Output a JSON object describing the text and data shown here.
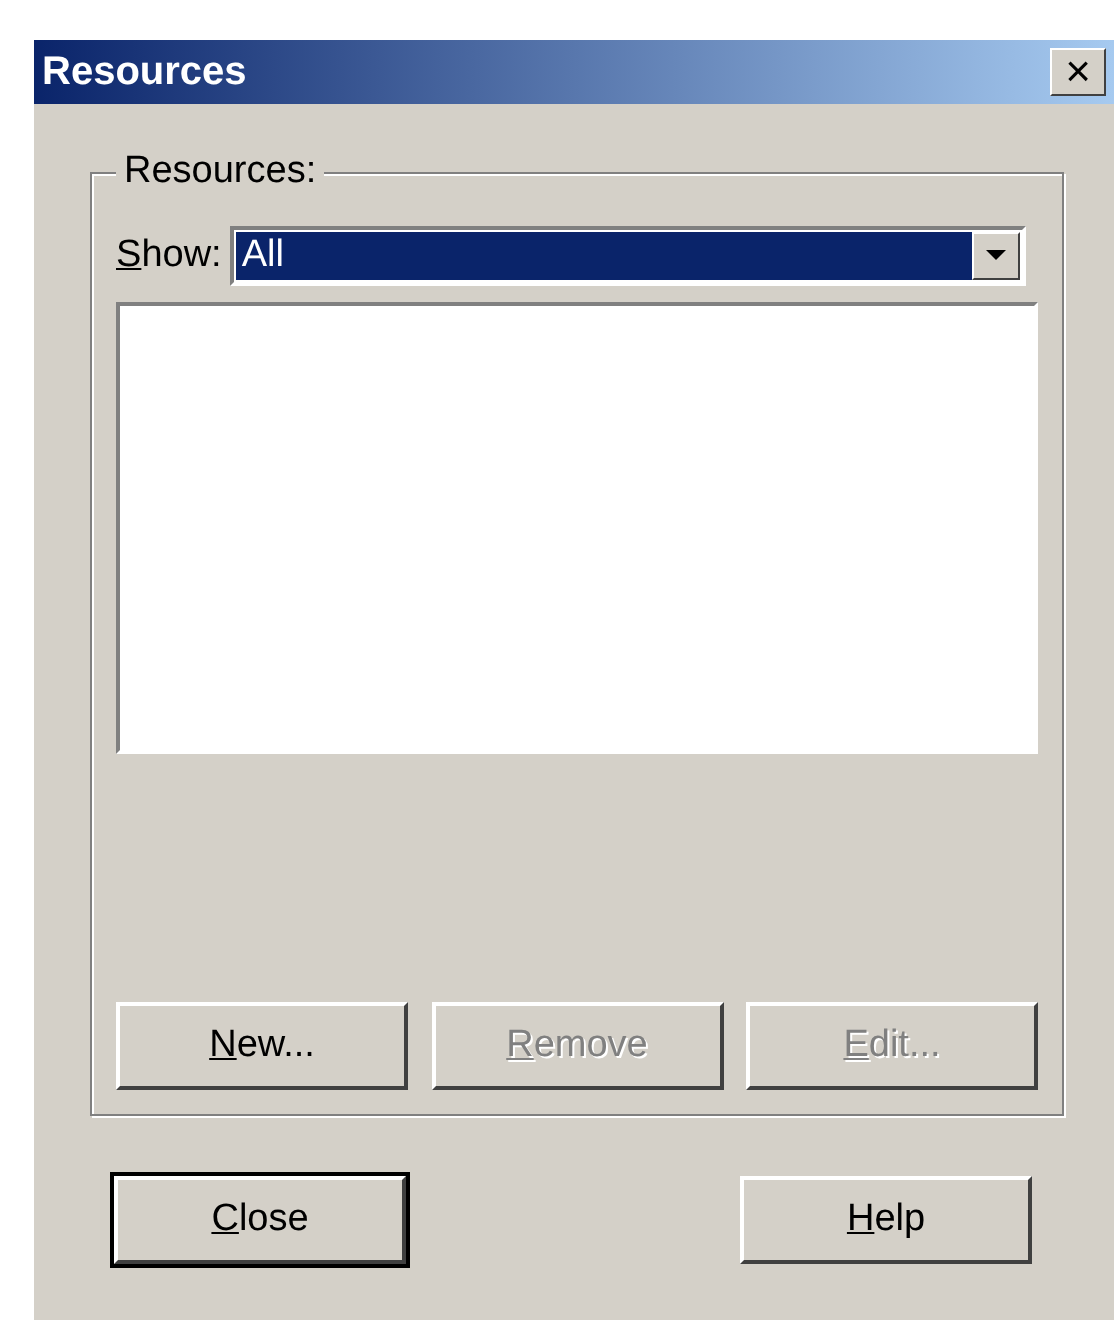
{
  "window": {
    "title": "Resources",
    "close_symbol": "×"
  },
  "group": {
    "label": "Resources:",
    "show": {
      "label": "Show:",
      "access_key_underlined": true,
      "value": "All",
      "focused": true
    },
    "buttons": [
      {
        "label": "New...",
        "disabled": false,
        "access_key_underlined": true
      },
      {
        "label": "Remove",
        "disabled": true,
        "access_key_underlined": true
      },
      {
        "label": "Edit...",
        "disabled": true,
        "access_key_underlined": true
      }
    ]
  },
  "buttons": [
    {
      "label": "Close",
      "default": true,
      "access_key_underlined": true
    },
    {
      "label": "Help",
      "default": false,
      "access_key_underlined": true
    }
  ]
}
